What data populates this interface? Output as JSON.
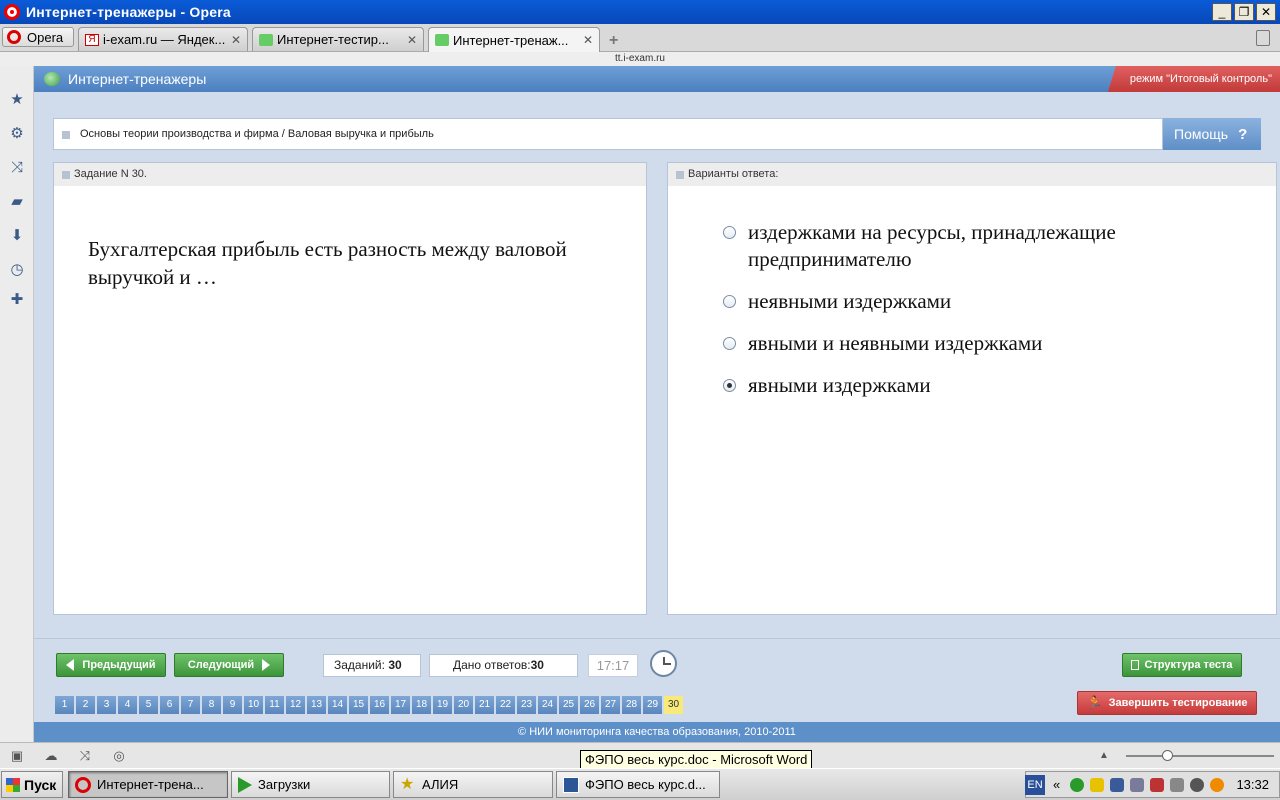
{
  "window": {
    "title": "Интернет-тренажеры - Opera",
    "buttons": [
      "_",
      "❐",
      "✕"
    ]
  },
  "browser": {
    "menu_label": "Opera",
    "tabs": [
      {
        "label": "i-exam.ru — Яндек...",
        "close": "✕"
      },
      {
        "label": "Интернет-тестир...",
        "close": "✕"
      },
      {
        "label": "Интернет-тренаж...",
        "close": "✕"
      }
    ],
    "new_tab": "+",
    "address": "tt.i-exam.ru"
  },
  "app": {
    "title": "Интернет-тренажеры",
    "mode": "режим \"Итоговый контроль\"",
    "topic": "Основы теории производства и фирма / Валовая выручка и прибыль",
    "help_label": "Помощь",
    "help_icon": "?"
  },
  "task": {
    "header": "Задание N 30.",
    "question": "Бухгалтерская прибыль есть разность между валовой выручкой и …"
  },
  "answers": {
    "header": "Варианты ответа:",
    "options": [
      {
        "label": "издержками на ресурсы, принадлежащие предпринимателю",
        "selected": false
      },
      {
        "label": "неявными издержками",
        "selected": false
      },
      {
        "label": "явными и неявными издержками",
        "selected": false
      },
      {
        "label": "явными издержками",
        "selected": true
      }
    ]
  },
  "controls": {
    "prev_label": "Предыдущий",
    "next_label": "Следующий",
    "tasks_label": "Заданий:",
    "tasks_count": "30",
    "answered_label": "Дано ответов:",
    "answered_count": "30",
    "timer": "17:17",
    "structure_label": "Структура теста",
    "finish_label": "Завершить тестирование",
    "question_numbers": [
      "1",
      "2",
      "3",
      "4",
      "5",
      "6",
      "7",
      "8",
      "9",
      "10",
      "11",
      "12",
      "13",
      "14",
      "15",
      "16",
      "17",
      "18",
      "19",
      "20",
      "21",
      "22",
      "23",
      "24",
      "25",
      "26",
      "27",
      "28",
      "29",
      "30"
    ],
    "current_number": "30"
  },
  "footer": "© НИИ мониторинга качества образования, 2010-2011",
  "statusbar": {
    "tooltip": "ФЭПО весь курс.doc - Microsoft Word"
  },
  "taskbar": {
    "start_label": "Пуск",
    "items": [
      {
        "label": "Интернет-трена..."
      },
      {
        "label": "Загрузки"
      },
      {
        "label": "АЛИЯ"
      },
      {
        "label": "ФЭПО весь курс.d..."
      }
    ],
    "lang": "EN",
    "chevron": "«",
    "clock": "13:32"
  },
  "colors": {
    "header_blue": "#5d8fc9",
    "green_button": "#3c953a",
    "red_button": "#c63a3a",
    "current_number": "#f7e97a"
  }
}
